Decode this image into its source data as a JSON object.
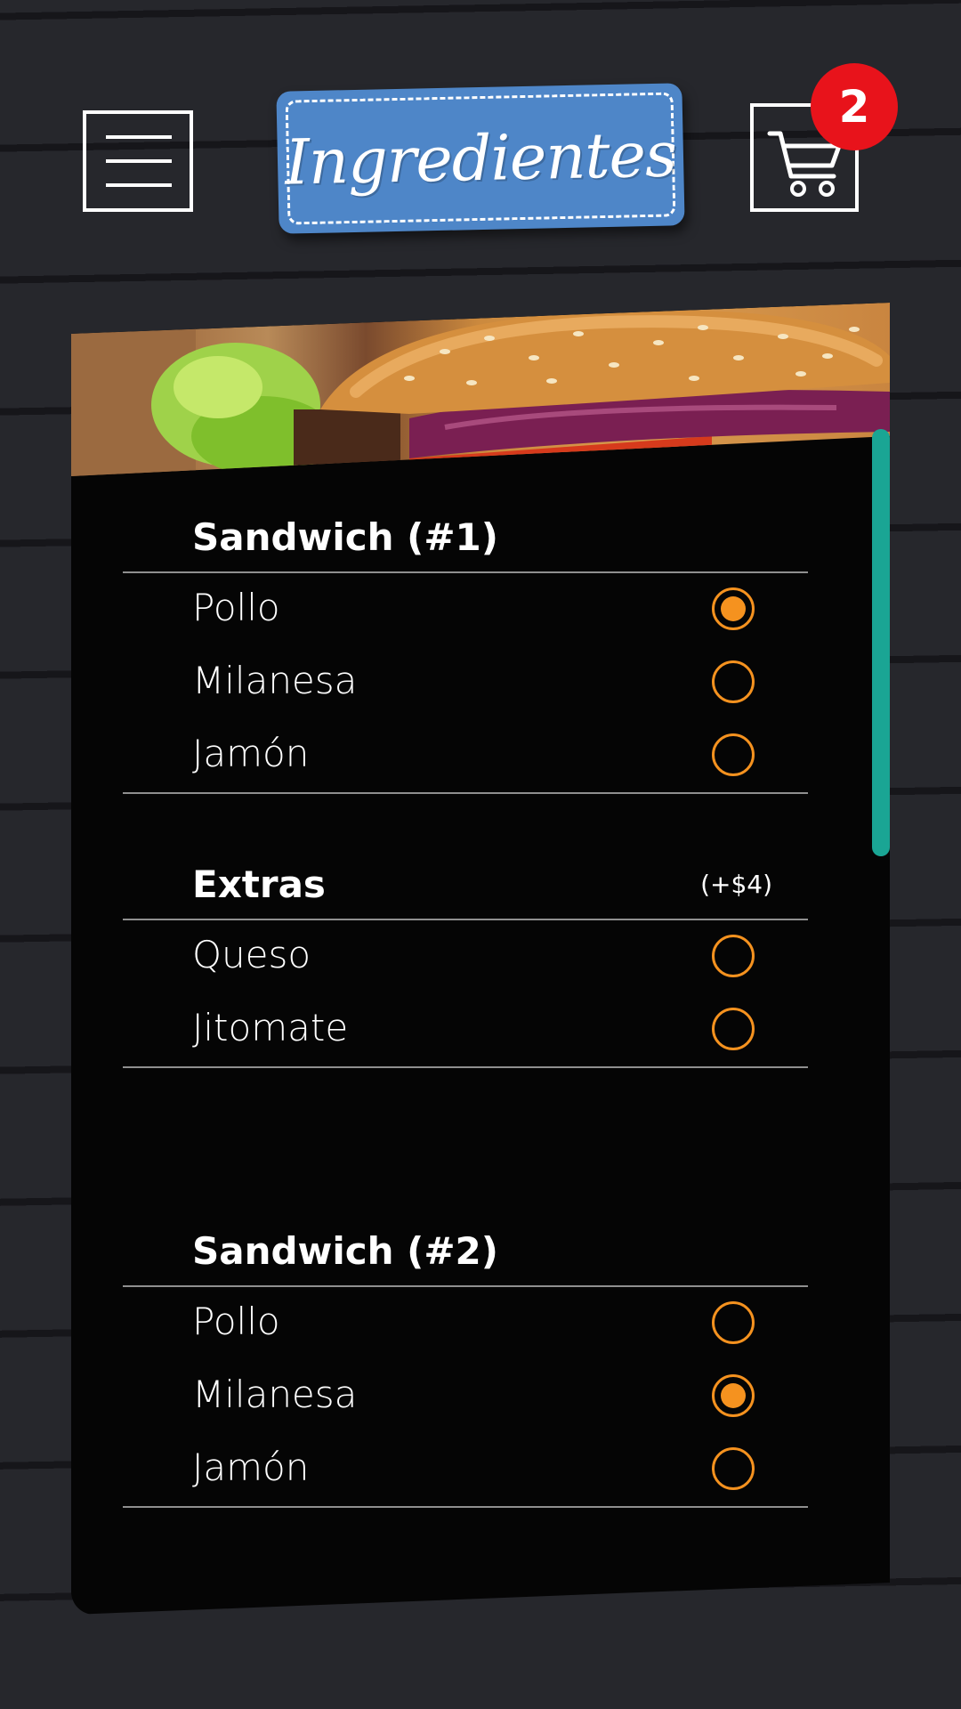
{
  "header": {
    "title": "Ingredientes",
    "cart_count": "2",
    "icons": {
      "menu": "hamburger-menu-icon",
      "cart": "shopping-cart-icon"
    }
  },
  "colors": {
    "accent": "#f5921f",
    "logo_bg": "#4e86c8",
    "badge": "#e8131b",
    "scrollbar": "#1aa594",
    "background": "#26272c"
  },
  "sections": [
    {
      "title": "Sandwich (#1)",
      "price": "",
      "options": [
        {
          "label": "Pollo",
          "selected": true
        },
        {
          "label": "Milanesa",
          "selected": false
        },
        {
          "label": "Jamón",
          "selected": false
        }
      ]
    },
    {
      "title": "Extras",
      "price": "(+$4)",
      "options": [
        {
          "label": "Queso",
          "selected": false
        },
        {
          "label": "Jitomate",
          "selected": false
        }
      ]
    },
    {
      "title": "Sandwich (#2)",
      "price": "",
      "options": [
        {
          "label": "Pollo",
          "selected": false
        },
        {
          "label": "Milanesa",
          "selected": true
        },
        {
          "label": "Jamón",
          "selected": false
        }
      ]
    }
  ]
}
